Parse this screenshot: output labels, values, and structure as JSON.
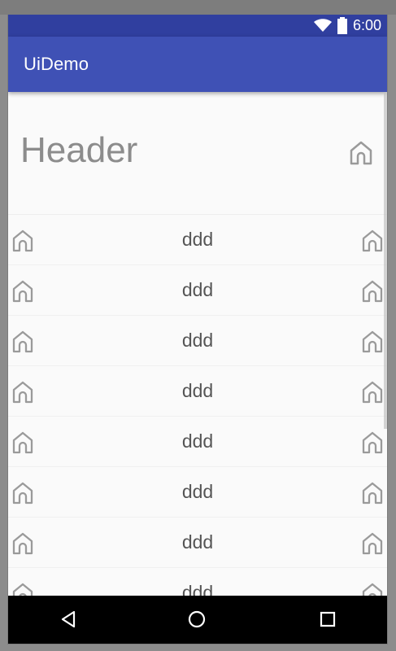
{
  "app": {
    "title": "UiDemo"
  },
  "statusbar": {
    "time": "6:00",
    "icons": [
      "wifi-icon",
      "battery-icon"
    ]
  },
  "header": {
    "title": "Header",
    "icon": "home-icon"
  },
  "list": {
    "items": [
      {
        "label": "ddd",
        "left_icon": "home-icon",
        "right_icon": "home-icon"
      },
      {
        "label": "ddd",
        "left_icon": "home-icon",
        "right_icon": "home-icon"
      },
      {
        "label": "ddd",
        "left_icon": "home-icon",
        "right_icon": "home-icon"
      },
      {
        "label": "ddd",
        "left_icon": "home-icon",
        "right_icon": "home-icon"
      },
      {
        "label": "ddd",
        "left_icon": "home-icon",
        "right_icon": "home-icon"
      },
      {
        "label": "ddd",
        "left_icon": "home-icon",
        "right_icon": "home-icon"
      },
      {
        "label": "ddd",
        "left_icon": "home-icon",
        "right_icon": "home-icon"
      },
      {
        "label": "ddd",
        "left_icon": "home-icon",
        "right_icon": "home-icon"
      }
    ]
  },
  "navigation": {
    "buttons": [
      "back-icon",
      "home-circle-icon",
      "recent-apps-icon"
    ]
  },
  "colors": {
    "status_bar": "#303f9f",
    "app_bar": "#3f51b5",
    "background": "#fafafa",
    "header_text": "#8c8c8c",
    "list_text": "#555555",
    "icon_gray": "#9a9a9a",
    "navigation_bar": "#000000"
  }
}
